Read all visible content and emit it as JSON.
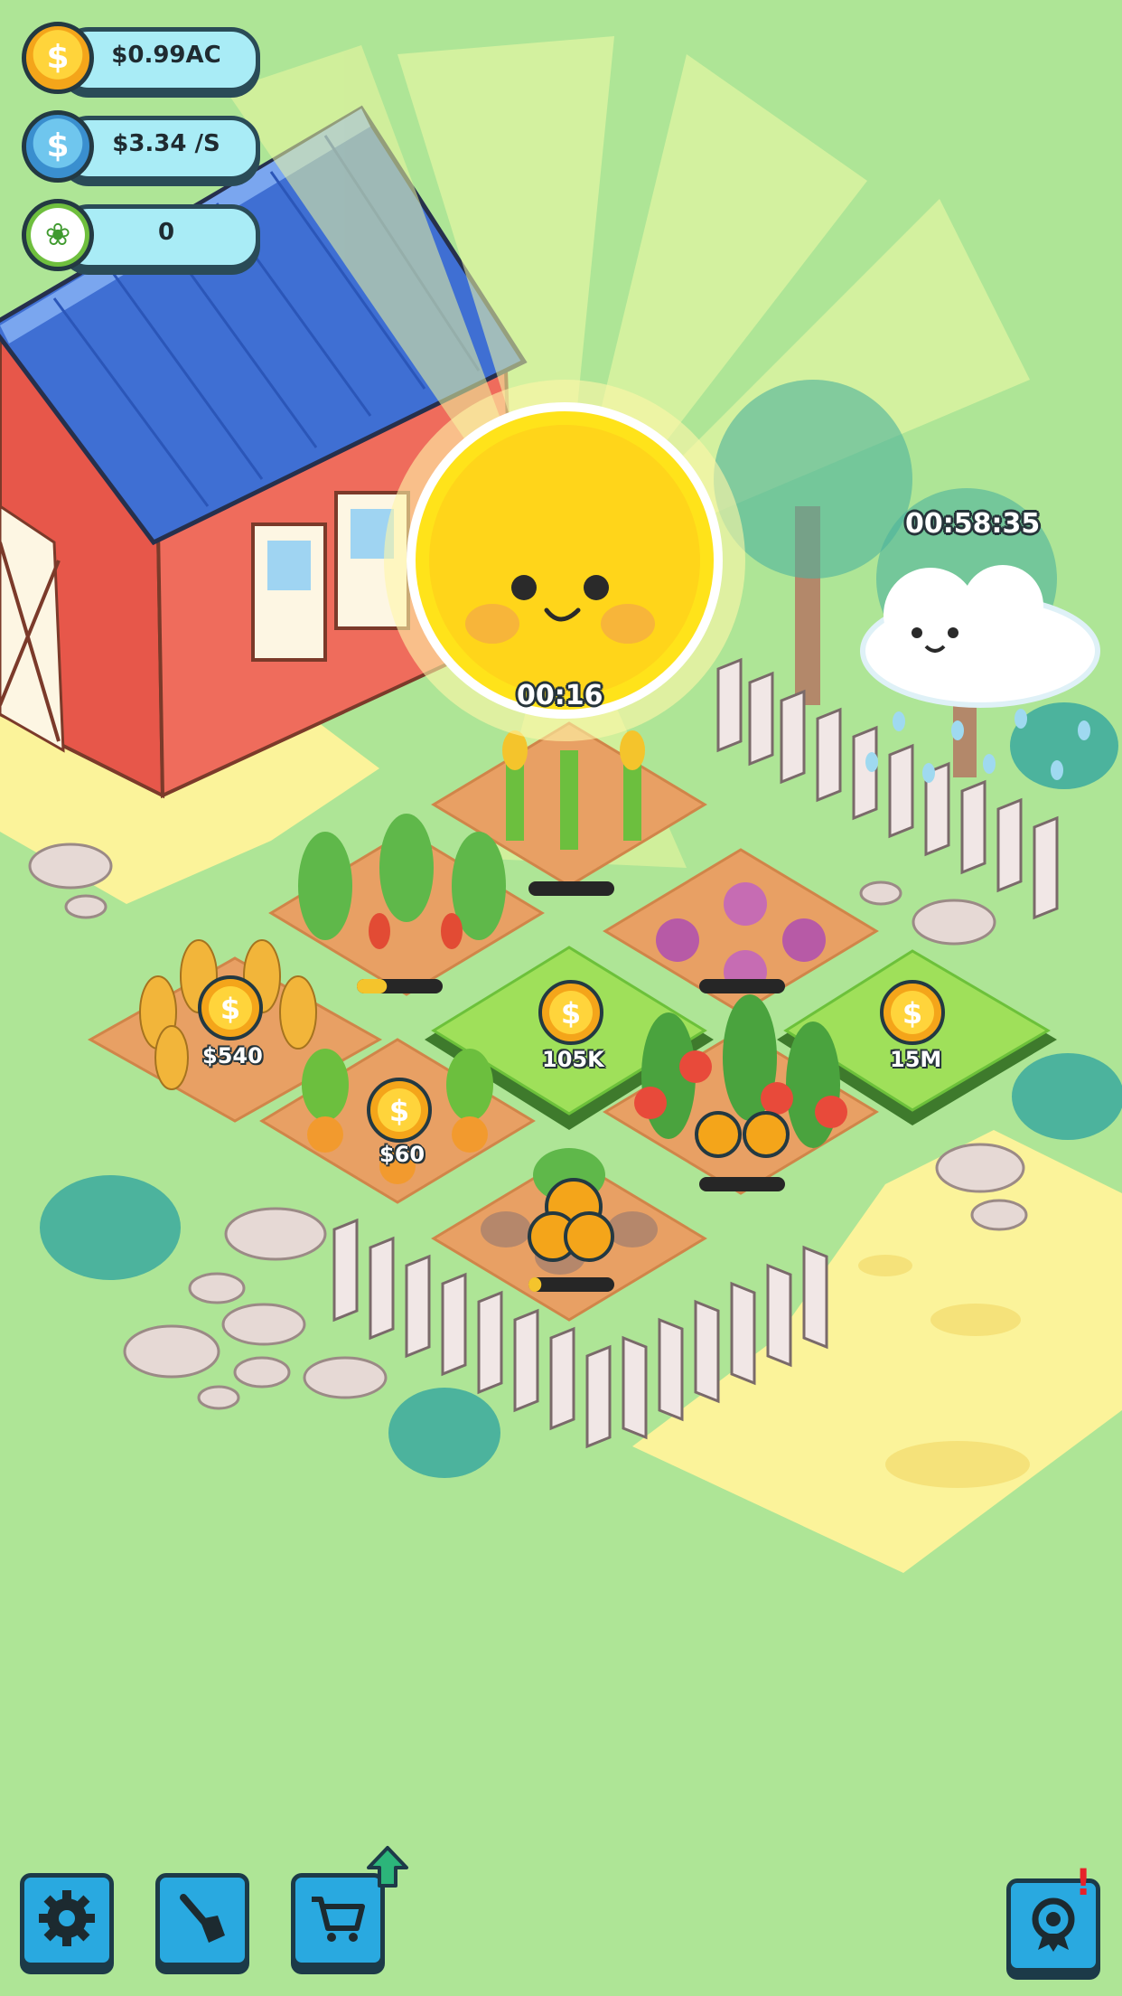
{
  "hud": {
    "coins": "$0.99AC",
    "rate": "$3.34 /S",
    "leaves": "0"
  },
  "timers": {
    "sun": "00:16",
    "cloud": "00:58:35"
  },
  "plots": [
    {
      "crop": "wheat",
      "coin_label": "$540"
    },
    {
      "crop": "carrot",
      "coin_label": "$60"
    },
    {
      "crop": "locked-plot",
      "coin_label": "105K"
    },
    {
      "crop": "locked-plot",
      "coin_label": "15M"
    },
    {
      "crop": "tomato",
      "coin_label": ""
    },
    {
      "crop": "corn",
      "coin_label": ""
    },
    {
      "crop": "onion",
      "coin_label": ""
    },
    {
      "crop": "potato",
      "coin_label": ""
    },
    {
      "crop": "pepper",
      "coin_label": ""
    }
  ],
  "progress": {
    "pepper": 0.35,
    "onion": 0.0,
    "corn": 0.0,
    "tomato": 0.0,
    "potato": 0.15
  },
  "toolbar": {
    "settings_icon": "gear-icon",
    "shovel_icon": "shovel-icon",
    "shop_icon": "cart-icon",
    "shop_upgrade_icon": "arrow-up-icon",
    "achievements_icon": "badge-icon",
    "achievements_alert": "!"
  },
  "colors": {
    "grass": "#aee596",
    "soil": "#e8a064",
    "roof": "#3f6fd3",
    "barn": "#e7574a",
    "button": "#29a9e0",
    "alert": "#e6222a"
  }
}
